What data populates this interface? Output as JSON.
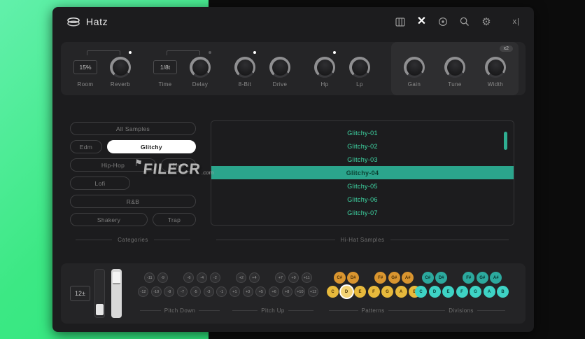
{
  "titlebar": {
    "title": "Hatz",
    "resize_label": "x|"
  },
  "fx": {
    "groups": [
      {
        "kind": "value",
        "text": "15%",
        "label": "Room",
        "led": "",
        "bracket": true,
        "gap": false
      },
      {
        "kind": "knob",
        "label": "Reverb",
        "led": "white",
        "gap": true
      },
      {
        "kind": "value",
        "text": "1/8t",
        "label": "Time",
        "led": "",
        "bracket": true,
        "gap": false
      },
      {
        "kind": "knob",
        "label": "Delay",
        "led": "gray",
        "gap": true
      },
      {
        "kind": "knob",
        "label": "8-Bit",
        "led": "white",
        "gap": false
      },
      {
        "kind": "knob",
        "label": "Drive",
        "led": "",
        "gap": true
      },
      {
        "kind": "knob",
        "label": "Hp",
        "led": "white",
        "gap": false
      },
      {
        "kind": "knob",
        "label": "Lp",
        "led": "",
        "gap": false
      }
    ],
    "output": {
      "badge": "x2",
      "knobs": [
        "Gain",
        "Tune",
        "Width"
      ]
    }
  },
  "categories": {
    "label": "Categories",
    "rows": [
      [
        {
          "label": "All Samples",
          "size": "fill",
          "selected": false
        }
      ],
      [
        {
          "label": "Edm",
          "size": "w46",
          "selected": false
        },
        {
          "label": "Glitchy",
          "size": "fill",
          "selected": true
        }
      ],
      [
        {
          "label": "Hip-Hop",
          "size": "fill",
          "selected": false
        },
        {
          "label": "Live",
          "size": "w50",
          "selected": false
        }
      ],
      [
        {
          "label": "Lofi",
          "size": "w86",
          "selected": false
        }
      ],
      [
        {
          "label": "R&B",
          "size": "fill",
          "selected": false
        }
      ],
      [
        {
          "label": "Shakery",
          "size": "fill",
          "selected": false
        },
        {
          "label": "Trap",
          "size": "w62",
          "selected": false
        }
      ]
    ]
  },
  "samples": {
    "label": "Hi-Hat Samples",
    "items": [
      "Glitchy-01",
      "Glitchy-02",
      "Glitchy-03",
      "Glitchy-04",
      "Glitchy-05",
      "Glitchy-06",
      "Glitchy-07"
    ],
    "selected": "Glitchy-04"
  },
  "pitch": {
    "display": "12±",
    "down_label": "Pitch Down",
    "up_label": "Pitch Up",
    "top_row": [
      "-11",
      "-9",
      "-6",
      "-4",
      "-2",
      "+2",
      "+4",
      "+7",
      "+9",
      "+11"
    ],
    "bottom_row": [
      "-12",
      "-10",
      "-8",
      "-7",
      "-5",
      "-3",
      "-1",
      "+1",
      "+3",
      "+5",
      "+6",
      "+8",
      "+10",
      "+12"
    ]
  },
  "patterns": {
    "label": "Patterns",
    "sharps": [
      "C#",
      "D#",
      "F#",
      "G#",
      "A#"
    ],
    "naturals": [
      "C",
      "D",
      "E",
      "F",
      "G",
      "A",
      "B"
    ],
    "selected": "D"
  },
  "divisions": {
    "label": "Divisions",
    "sharps": [
      "C#",
      "D#",
      "F#",
      "G#",
      "A#"
    ],
    "naturals": [
      "C",
      "D",
      "E",
      "F",
      "G",
      "A",
      "B"
    ],
    "selected": ""
  },
  "watermark": {
    "text": "FILECR",
    "suffix": ".com"
  },
  "colors": {
    "accent_teal": "#3fd9a6",
    "selected_row_bg": "#2ba58c",
    "pattern_yellow": "#e7b93c",
    "pattern_orange": "#d9952f",
    "division_teal": "#3ed3c5",
    "division_dark_teal": "#2ca99e"
  }
}
